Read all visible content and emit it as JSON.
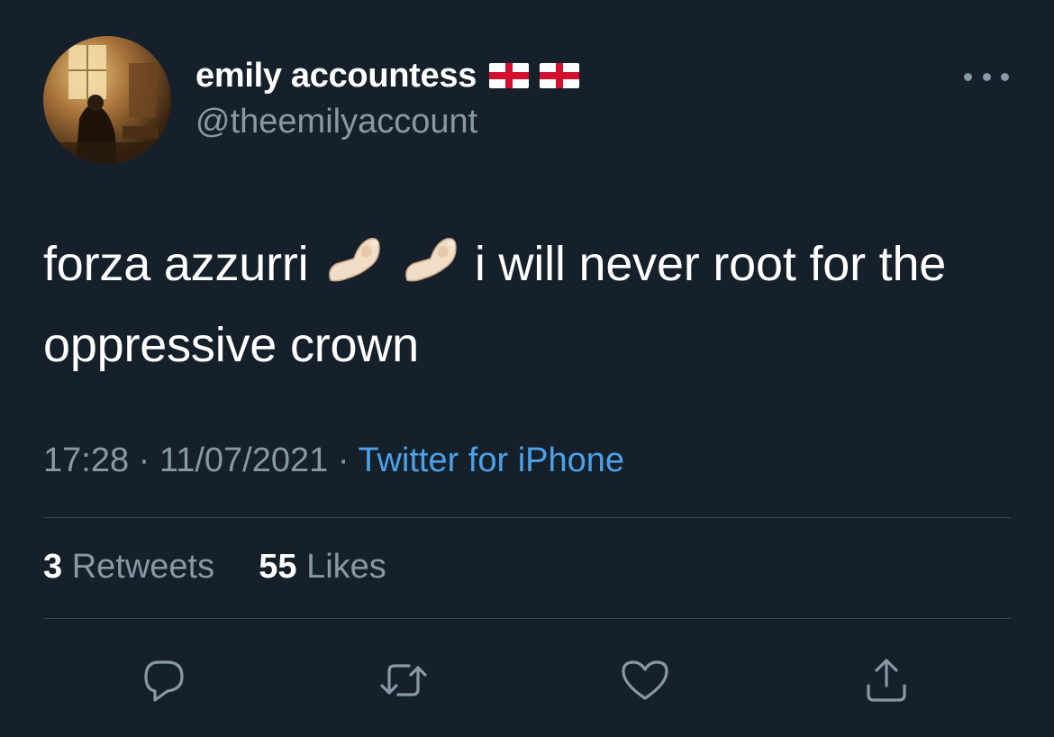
{
  "author": {
    "display_name": "emily accountess",
    "handle": "@theemilyaccount",
    "flags": [
      "england-flag",
      "england-flag"
    ]
  },
  "tweet": {
    "text_part1": "forza azzurri",
    "emojis": [
      "pinched-fingers-emoji",
      "pinched-fingers-emoji"
    ],
    "text_part2": "i will never root for the oppressive crown"
  },
  "meta": {
    "time": "17:28",
    "separator": "·",
    "date": "11/07/2021",
    "source": "Twitter for iPhone"
  },
  "stats": {
    "retweets_count": "3",
    "retweets_label": "Retweets",
    "likes_count": "55",
    "likes_label": "Likes"
  },
  "actions": [
    "reply-icon",
    "retweet-icon",
    "like-icon",
    "share-icon"
  ],
  "colors": {
    "background": "#15202b",
    "secondary_text": "#8899a6",
    "link": "#4da1e8",
    "divider": "#38444d"
  }
}
